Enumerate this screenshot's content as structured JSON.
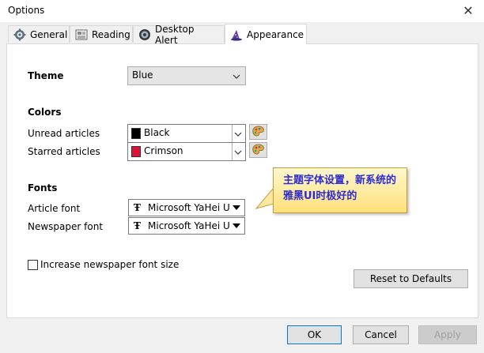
{
  "window": {
    "title": "Options",
    "close_symbol": "✕"
  },
  "tabs": [
    {
      "label": "General",
      "icon": "gear-icon",
      "active": false
    },
    {
      "label": "Reading",
      "icon": "newspaper-icon",
      "active": false
    },
    {
      "label": "Desktop Alert",
      "icon": "alert-icon",
      "active": false
    },
    {
      "label": "Appearance",
      "icon": "wizard-hat-icon",
      "active": true
    }
  ],
  "appearance": {
    "theme_label": "Theme",
    "theme_value": "Blue",
    "colors_heading": "Colors",
    "unread_label": "Unread articles",
    "unread_color_name": "Black",
    "unread_color_hex": "#000000",
    "starred_label": "Starred articles",
    "starred_color_name": "Crimson",
    "starred_color_hex": "#dc143c",
    "fonts_heading": "Fonts",
    "article_font_label": "Article font",
    "article_font_value": "Microsoft YaHei U",
    "newspaper_font_label": "Newspaper font",
    "newspaper_font_value": "Microsoft YaHei U",
    "increase_font_label": "Increase newspaper font size",
    "increase_font_checked": false,
    "reset_label": "Reset to Defaults"
  },
  "annotation": {
    "text": "主题字体设置，新系统的雅黑UI时极好的"
  },
  "buttons": {
    "ok": "OK",
    "cancel": "Cancel",
    "apply": "Apply"
  }
}
